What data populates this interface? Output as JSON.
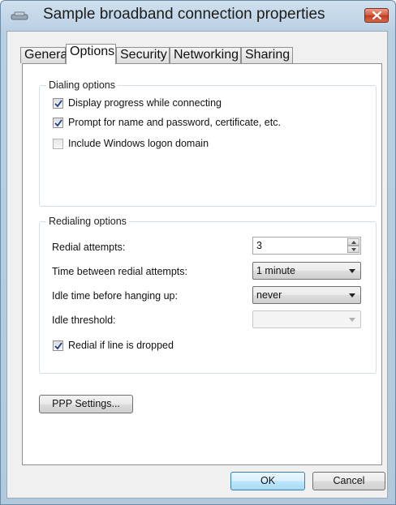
{
  "window": {
    "title": "Sample broadband connection properties",
    "title_icon": "network-connection-icon",
    "close_icon": "close-icon"
  },
  "tabs": [
    {
      "label": "General",
      "active": false
    },
    {
      "label": "Options",
      "active": true
    },
    {
      "label": "Security",
      "active": false
    },
    {
      "label": "Networking",
      "active": false
    },
    {
      "label": "Sharing",
      "active": false
    }
  ],
  "dialing": {
    "legend": "Dialing options",
    "options": [
      {
        "label": "Display progress while connecting",
        "checked": true
      },
      {
        "label": "Prompt for name and password, certificate, etc.",
        "checked": true
      },
      {
        "label": "Include Windows logon domain",
        "checked": false
      }
    ]
  },
  "redialing": {
    "legend": "Redialing options",
    "redial_attempts": {
      "label": "Redial attempts:",
      "value": "3"
    },
    "time_between": {
      "label": "Time between redial attempts:",
      "value": "1 minute"
    },
    "idle_time": {
      "label": "Idle time before hanging up:",
      "value": "never"
    },
    "idle_threshold": {
      "label": "Idle threshold:",
      "value": ""
    },
    "redial_if_dropped": {
      "label": "Redial if line is dropped",
      "checked": true
    }
  },
  "buttons": {
    "ppp": "PPP Settings...",
    "ok": "OK",
    "cancel": "Cancel"
  }
}
